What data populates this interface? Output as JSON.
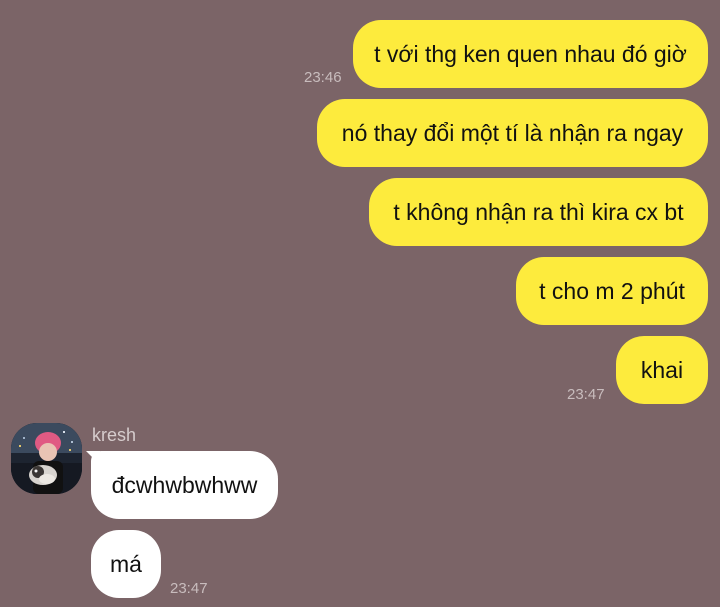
{
  "outgoing": [
    {
      "text": "t với thg ken quen nhau đó giờ"
    },
    {
      "text": "nó thay đổi một tí là nhận ra ngay"
    },
    {
      "text": "t không nhận ra thì kira cx bt"
    },
    {
      "text": "t cho m 2 phút"
    },
    {
      "text": "khai"
    }
  ],
  "outgoing_times": [
    "23:46",
    "23:47"
  ],
  "contact": {
    "name": "kresh"
  },
  "incoming": [
    {
      "text": "đcwhwbwhww"
    },
    {
      "text": "má"
    }
  ],
  "incoming_time": "23:47",
  "colors": {
    "background": "#7b6467",
    "outgoing_bubble": "#fdeb3d",
    "incoming_bubble": "#ffffff"
  }
}
